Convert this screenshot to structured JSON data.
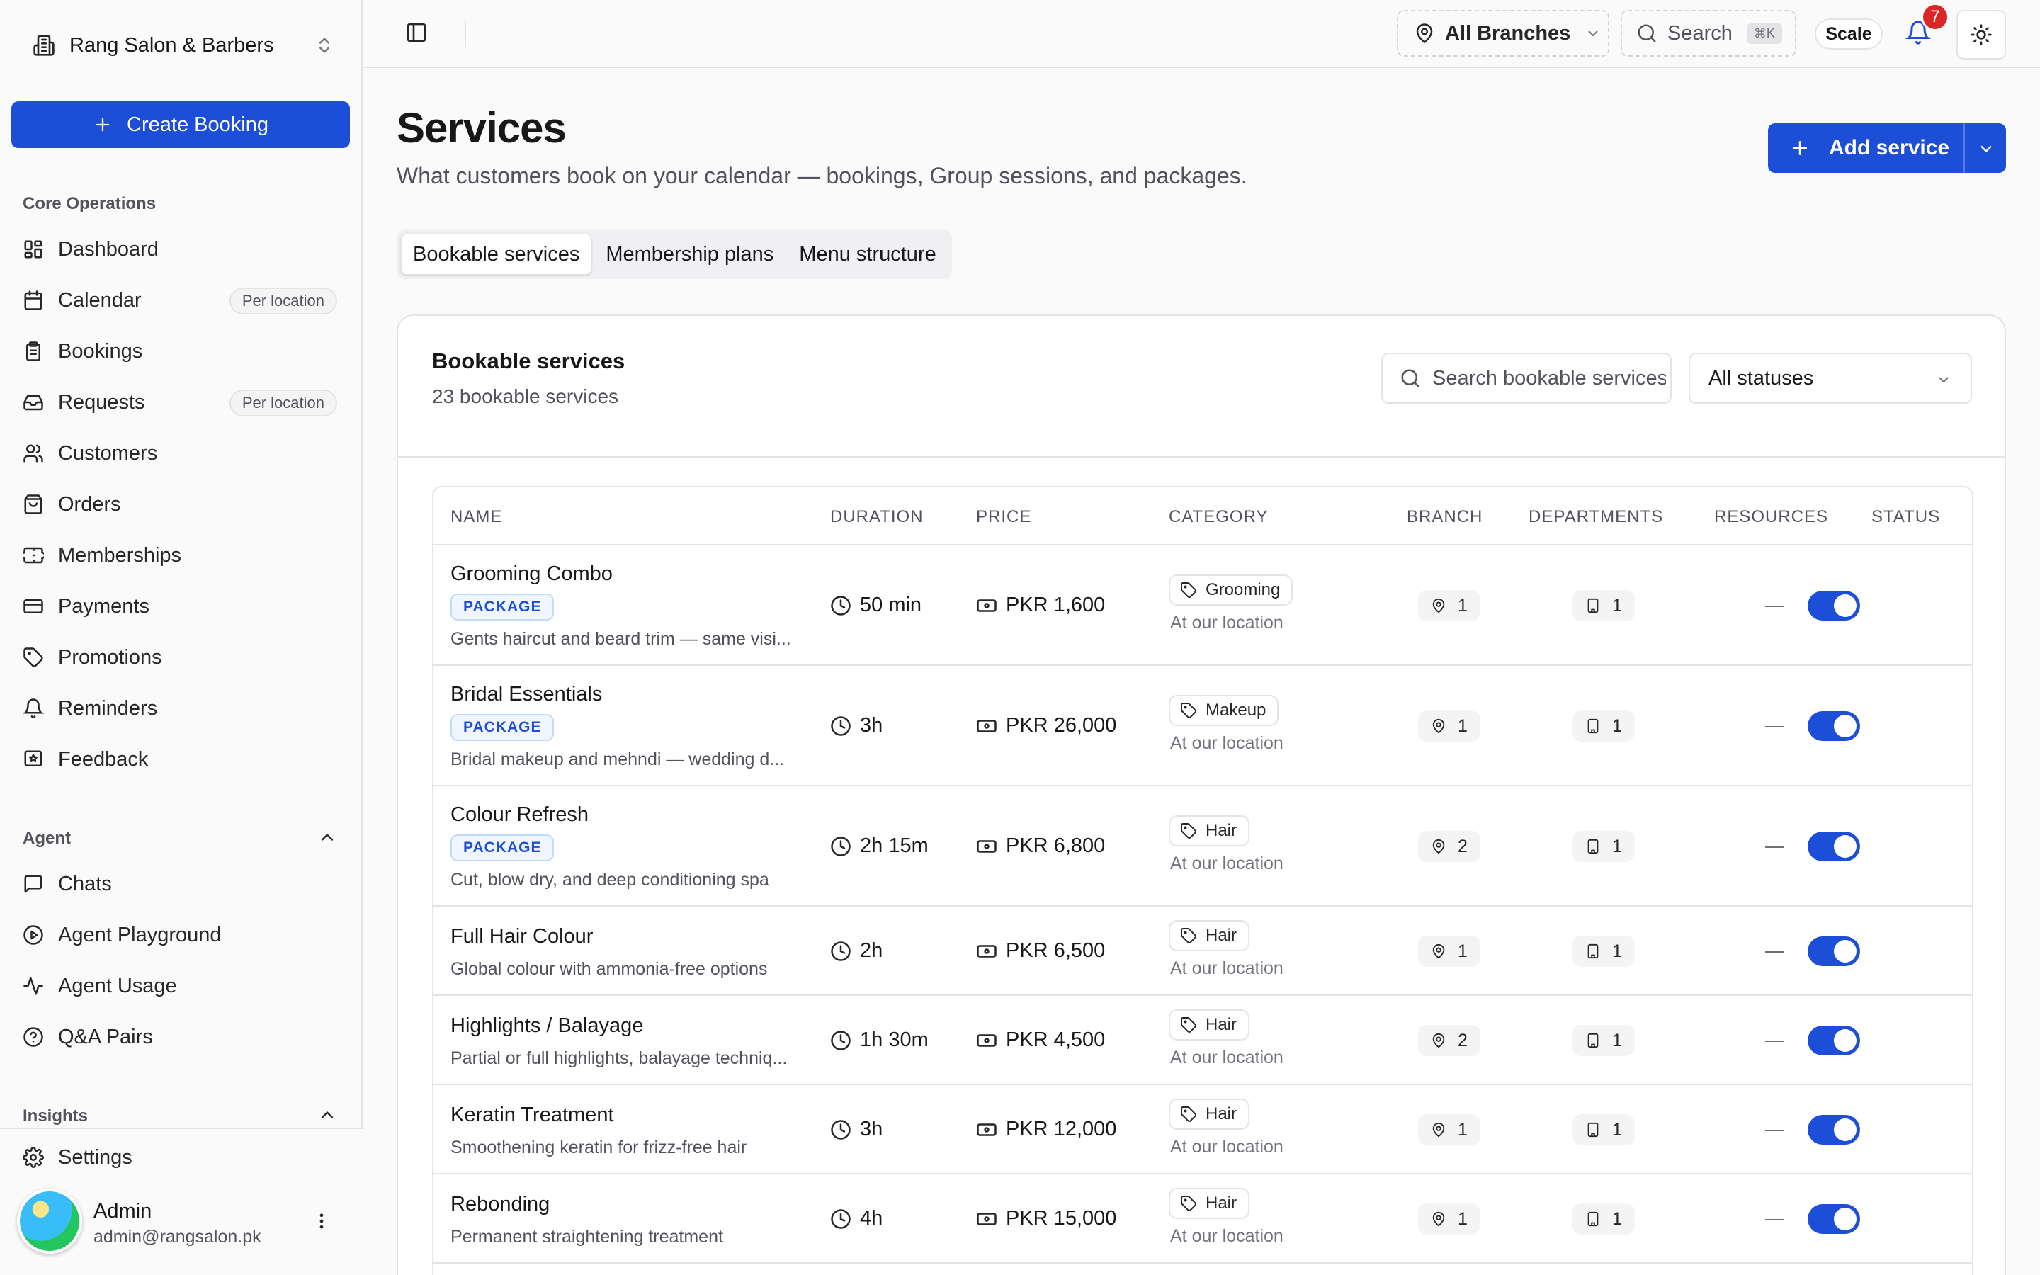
{
  "sidebar": {
    "org_name": "Rang Salon & Barbers",
    "create_booking": "Create Booking",
    "sections": {
      "core": "Core Operations",
      "agent": "Agent",
      "insights": "Insights"
    },
    "core_items": [
      {
        "label": "Dashboard",
        "icon": "dashboard-icon"
      },
      {
        "label": "Calendar",
        "icon": "calendar-icon",
        "badge": "Per location"
      },
      {
        "label": "Bookings",
        "icon": "clipboard-icon"
      },
      {
        "label": "Requests",
        "icon": "inbox-icon",
        "badge": "Per location"
      },
      {
        "label": "Customers",
        "icon": "users-icon"
      },
      {
        "label": "Orders",
        "icon": "shopping-bag-icon"
      },
      {
        "label": "Memberships",
        "icon": "ticket-icon"
      },
      {
        "label": "Payments",
        "icon": "credit-card-icon"
      },
      {
        "label": "Promotions",
        "icon": "tag-icon"
      },
      {
        "label": "Reminders",
        "icon": "bell-icon"
      },
      {
        "label": "Feedback",
        "icon": "feedback-icon"
      }
    ],
    "agent_items": [
      {
        "label": "Chats",
        "icon": "chat-icon"
      },
      {
        "label": "Agent Playground",
        "icon": "play-icon"
      },
      {
        "label": "Agent Usage",
        "icon": "activity-icon"
      },
      {
        "label": "Q&A Pairs",
        "icon": "help-icon"
      }
    ],
    "settings": "Settings",
    "user": {
      "name": "Admin",
      "email": "admin@rangsalon.pk"
    }
  },
  "topbar": {
    "branch": "All Branches",
    "search": "Search",
    "shortcut": "⌘K",
    "scale": "Scale",
    "notifications": "7"
  },
  "page": {
    "title": "Services",
    "subtitle": "What customers book on your calendar — bookings, Group sessions, and packages.",
    "add_service": "Add service",
    "tabs": [
      "Bookable services",
      "Membership plans",
      "Menu structure"
    ]
  },
  "card": {
    "title": "Bookable services",
    "count": "23 bookable services",
    "search_placeholder": "Search bookable services",
    "status_filter": "All statuses"
  },
  "table": {
    "columns": [
      "NAME",
      "DURATION",
      "PRICE",
      "CATEGORY",
      "BRANCH",
      "DEPARTMENTS",
      "RESOURCES",
      "STATUS"
    ],
    "rows": [
      {
        "name": "Grooming Combo",
        "package": "PACKAGE",
        "desc": "Gents haircut and beard trim — same visi...",
        "duration": "50 min",
        "price": "PKR 1,600",
        "category": "Grooming",
        "location": "At our location",
        "branch": "1",
        "departments": "1",
        "resources": "—",
        "active": true
      },
      {
        "name": "Bridal Essentials",
        "package": "PACKAGE",
        "desc": "Bridal makeup and mehndi — wedding d...",
        "duration": "3h",
        "price": "PKR 26,000",
        "category": "Makeup",
        "location": "At our location",
        "branch": "1",
        "departments": "1",
        "resources": "—",
        "active": true
      },
      {
        "name": "Colour Refresh",
        "package": "PACKAGE",
        "desc": "Cut, blow dry, and deep conditioning spa",
        "duration": "2h 15m",
        "price": "PKR 6,800",
        "category": "Hair",
        "location": "At our location",
        "branch": "2",
        "departments": "1",
        "resources": "—",
        "active": true
      },
      {
        "name": "Full Hair Colour",
        "desc": "Global colour with ammonia-free options",
        "duration": "2h",
        "price": "PKR 6,500",
        "category": "Hair",
        "location": "At our location",
        "branch": "1",
        "departments": "1",
        "resources": "—",
        "active": true
      },
      {
        "name": "Highlights / Balayage",
        "desc": "Partial or full highlights, balayage techniq...",
        "duration": "1h 30m",
        "price": "PKR 4,500",
        "category": "Hair",
        "location": "At our location",
        "branch": "2",
        "departments": "1",
        "resources": "—",
        "active": true
      },
      {
        "name": "Keratin Treatment",
        "desc": "Smoothening keratin for frizz-free hair",
        "duration": "3h",
        "price": "PKR 12,000",
        "category": "Hair",
        "location": "At our location",
        "branch": "1",
        "departments": "1",
        "resources": "—",
        "active": true
      },
      {
        "name": "Rebonding",
        "desc": "Permanent straightening treatment",
        "duration": "4h",
        "price": "PKR 15,000",
        "category": "Hair",
        "location": "At our location",
        "branch": "1",
        "departments": "1",
        "resources": "—",
        "active": true
      }
    ]
  },
  "colors": {
    "accent": "#1d4ed8",
    "notification": "#dc2626"
  }
}
